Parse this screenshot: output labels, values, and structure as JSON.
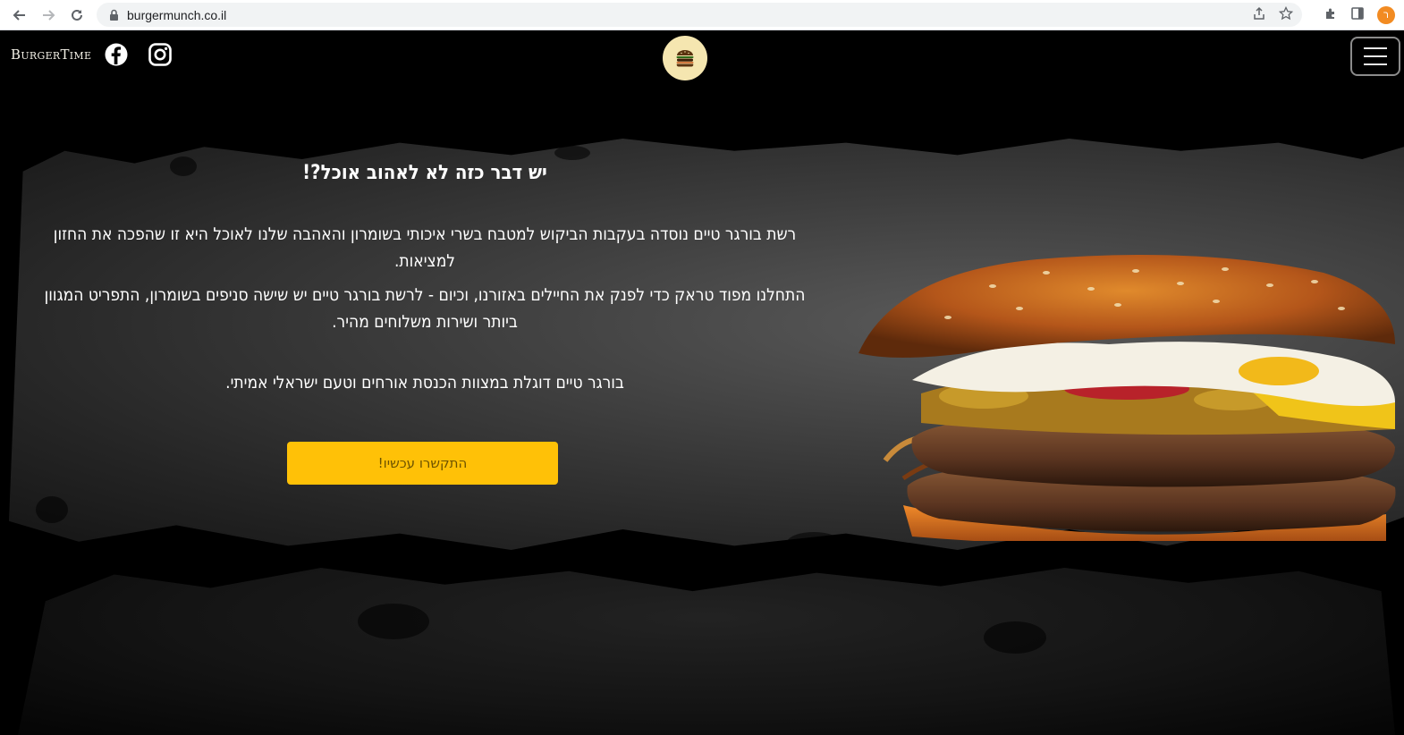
{
  "browser": {
    "url": "burgermunch.co.il",
    "profile_initial": "ר"
  },
  "header": {
    "brand": "BurgerTime"
  },
  "hero": {
    "title": "יש דבר כזה לא לאהוב אוכל?!",
    "paragraph_1": "רשת בורגר טיים נוסדה בעקבות הביקוש למטבח בשרי איכותי בשומרון והאהבה שלנו לאוכל היא זו שהפכה את החזון למציאות.",
    "paragraph_2": "התחלנו מפוד טראק כדי לפנק את החיילים באזורנו, וכיום - לרשת בורגר טיים יש שישה סניפים בשומרון, התפריט המגוון ביותר ושירות משלוחים מהיר.",
    "paragraph_3": "בורגר טיים דוגלת במצוות הכנסת אורחים וטעם ישראלי אמיתי.",
    "cta_label": "התקשרו עכשיו!"
  },
  "colors": {
    "cta": "#ffc107",
    "logo_bg": "#f5e6b0",
    "page_bg": "#000000"
  },
  "icons": [
    "back-icon",
    "forward-icon",
    "reload-icon",
    "lock-icon",
    "share-icon",
    "star-icon",
    "extensions-icon",
    "side-panel-icon",
    "facebook-icon",
    "instagram-icon",
    "burger-logo-icon",
    "menu-icon"
  ]
}
